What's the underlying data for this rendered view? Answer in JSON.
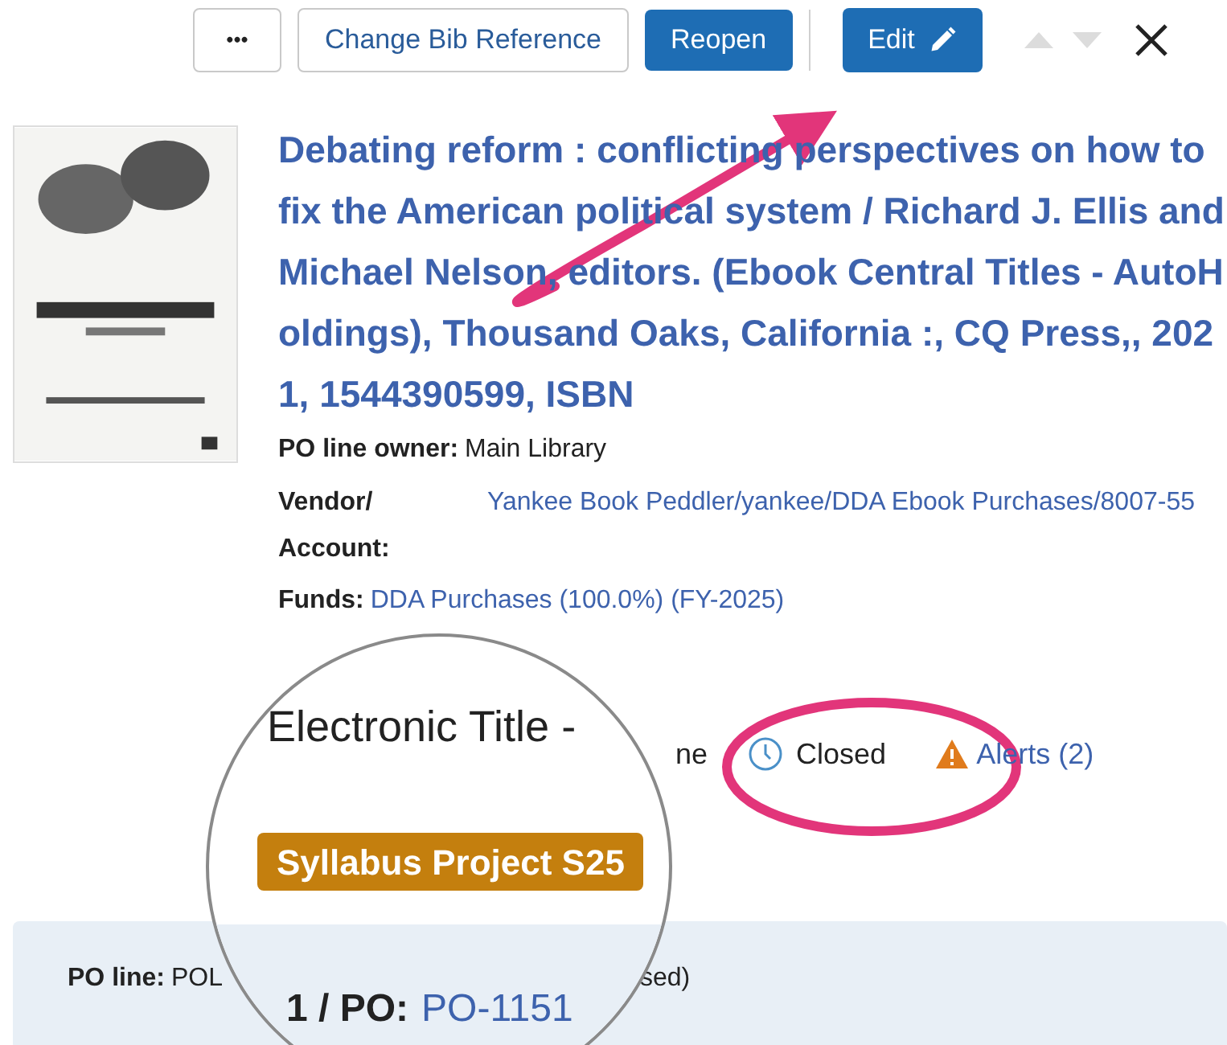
{
  "toolbar": {
    "more": "•••",
    "buttons": [
      {
        "label": "Change Bib Reference",
        "kind": "outline"
      },
      {
        "label": "Reopen",
        "kind": "primary"
      },
      {
        "label": "Edit",
        "kind": "edit"
      }
    ],
    "nav": [
      {
        "kind": "up",
        "disabled": true
      },
      {
        "kind": "down",
        "disabled": true
      }
    ]
  },
  "record": {
    "title": "Debating reform : conflicting perspectives on how to fix the American political system / Richard J. Ellis and Michael Nelson, editors. (Ebook Central Titles - AutoHoldings), Thousand Oaks, California :, CQ Press,, 2021, 1544390599, ISBN",
    "fields": [
      {
        "label": "PO line owner:",
        "value": "Main Library",
        "kind": "text"
      },
      {
        "label": "Vendor/ Account:",
        "value": "Yankee Book Peddler/yankee/DDA Ebook Purchases/8007-55",
        "kind": "link"
      },
      {
        "label": "Funds:",
        "value": "DDA Purchases (100.0%) (FY-2025)",
        "kind": "inline-link"
      }
    ]
  },
  "status": {
    "fragment": "ne",
    "state": "Closed",
    "alerts": "Alerts (2)"
  },
  "po_panel": {
    "label": "PO line:",
    "value_fragment": "POL",
    "tail_fragment": "sed)"
  },
  "magnifier": {
    "heading": "Electronic Title -",
    "tag": "Syllabus Project S25",
    "po_label": "1 / PO:",
    "po_link": "PO-1151"
  }
}
